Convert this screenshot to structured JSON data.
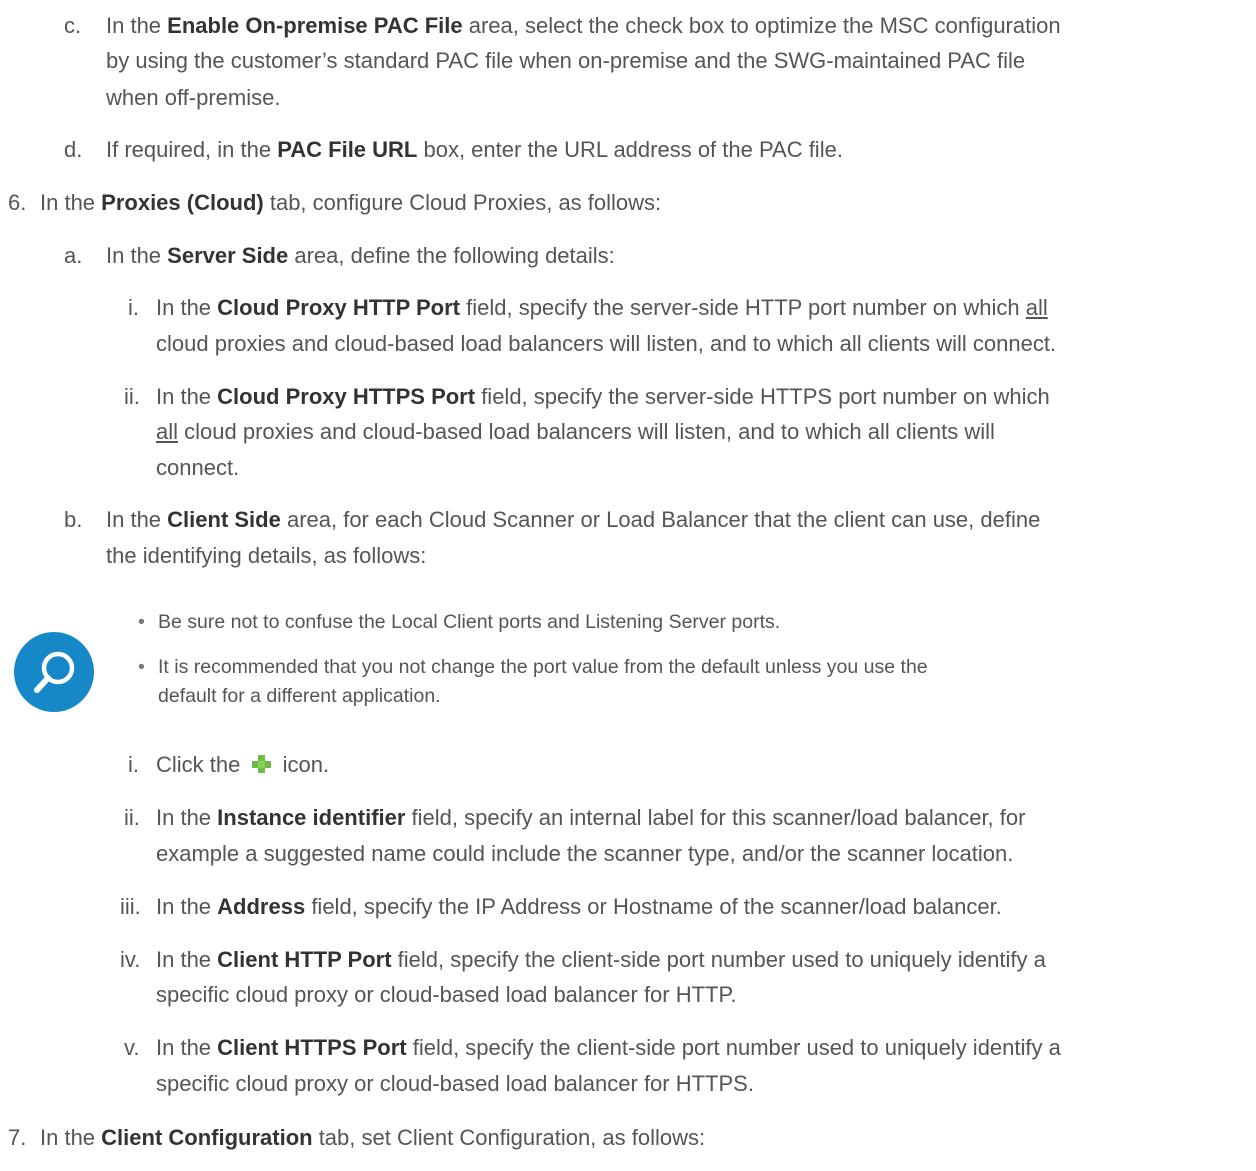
{
  "step_c": {
    "marker": "c.",
    "pre": "In the ",
    "bold": "Enable On-premise PAC File",
    "line1_rest": " area, select the check box to optimize the MSC configuration",
    "line2": "by using the customer’s standard PAC file when on-premise and the SWG-maintained PAC file",
    "line3": "when off-premise."
  },
  "step_d": {
    "marker": "d.",
    "pre": "If required, in the ",
    "bold": "PAC File URL",
    "rest": " box, enter the URL address of the PAC file."
  },
  "step_6": {
    "marker": "6.",
    "pre": "In the ",
    "bold": "Proxies (Cloud)",
    "rest": " tab, configure Cloud Proxies, as follows:"
  },
  "step_6a": {
    "marker": "a.",
    "pre": "In the ",
    "bold": "Server Side",
    "rest": " area, define the following details:"
  },
  "step_6a_i": {
    "marker": "i.",
    "pre": "In the ",
    "bold": "Cloud Proxy HTTP Port",
    "mid": " field, specify the server-side HTTP port number on which ",
    "underline": "all",
    "line2": "cloud proxies and cloud-based load balancers will listen, and to which all clients will connect."
  },
  "step_6a_ii": {
    "marker": "ii.",
    "pre": "In the ",
    "bold": "Cloud Proxy HTTPS Port",
    "rest": " field, specify the server-side HTTPS port number on which",
    "underline": "all",
    "line2_rest": " cloud proxies and cloud-based load balancers will listen, and to which all clients will",
    "line3": "connect."
  },
  "step_6b": {
    "marker": "b.",
    "pre": "In the ",
    "bold": "Client Side",
    "rest": " area, for each Cloud Scanner or Load Balancer that the client can use, define",
    "line2": "the identifying details, as follows:"
  },
  "note": {
    "icon": "magnifier-icon",
    "color": "#1688c8",
    "bullet1": "Be sure not to confuse the Local Client ports and Listening Server ports.",
    "bullet2_line1": "It is recommended that you not change the port value from the default unless you use the",
    "bullet2_line2": "default for a different application."
  },
  "step_6b_i": {
    "marker": "i.",
    "pre": "Click the",
    "icon": "plus-icon",
    "rest": "icon."
  },
  "step_6b_ii": {
    "marker": "ii.",
    "pre": "In the ",
    "bold": "Instance identifier",
    "rest": " field, specify an internal label for this scanner/load balancer, for",
    "line2": "example a suggested name could include the scanner type, and/or the scanner location."
  },
  "step_6b_iii": {
    "marker": "iii.",
    "pre": "In the ",
    "bold": "Address",
    "rest": " field, specify the IP Address or Hostname of the scanner/load balancer."
  },
  "step_6b_iv": {
    "marker": "iv.",
    "pre": "In the ",
    "bold": "Client HTTP Port",
    "rest": " field, specify the client-side port number used to uniquely identify a",
    "line2": "specific cloud proxy or cloud-based load balancer for HTTP."
  },
  "step_6b_v": {
    "marker": "v.",
    "pre": "In the ",
    "bold": "Client HTTPS Port",
    "rest": " field, specify the client-side port number used to uniquely identify a",
    "line2": "specific cloud proxy or cloud-based load balancer for HTTPS."
  },
  "step_7": {
    "marker": "7.",
    "pre": "In the ",
    "bold": "Client Configuration",
    "rest": " tab, set Client Configuration, as follows:"
  }
}
